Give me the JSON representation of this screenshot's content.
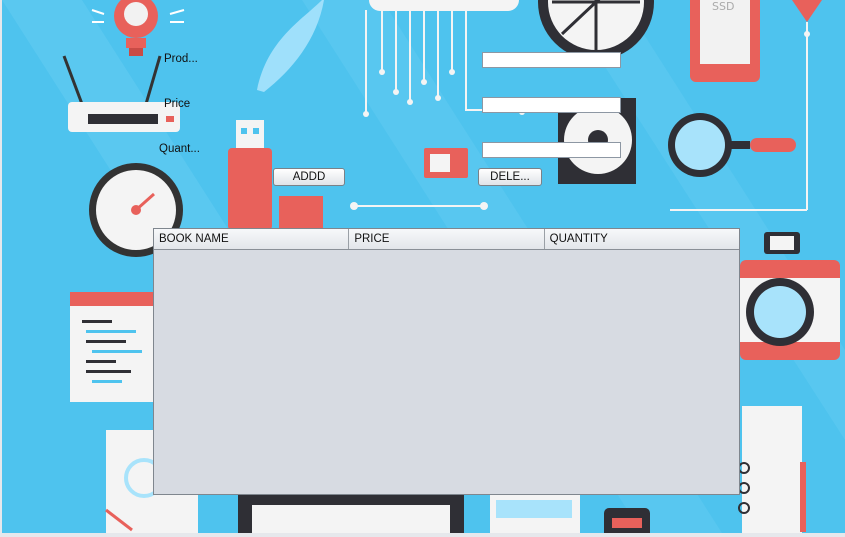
{
  "form": {
    "product_label": "Prod...",
    "price_label": "Price",
    "quantity_label": "Quant...",
    "product_value": "",
    "price_value": "",
    "quantity_value": ""
  },
  "buttons": {
    "add_label": "ADDD",
    "delete_label": "DELE..."
  },
  "table": {
    "columns": [
      "BOOK NAME",
      "PRICE",
      "QUANTITY"
    ],
    "rows": []
  },
  "colors": {
    "background": "#4ec3ee",
    "accent": "#e8615b",
    "table_body": "#d7dbe2"
  }
}
